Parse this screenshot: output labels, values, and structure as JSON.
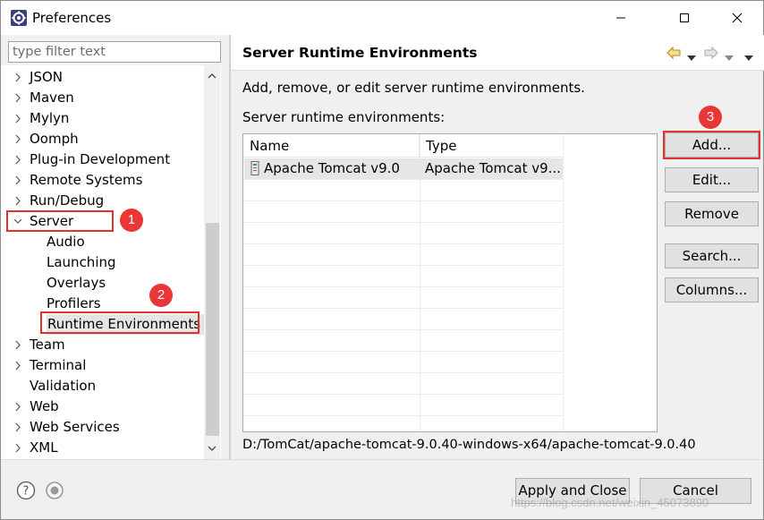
{
  "window": {
    "title": "Preferences",
    "icon": "eclipse-gear-icon"
  },
  "filter": {
    "placeholder": "type filter text"
  },
  "tree": {
    "items": [
      {
        "label": "JSON",
        "level": 0,
        "expandable": true
      },
      {
        "label": "Maven",
        "level": 0,
        "expandable": true
      },
      {
        "label": "Mylyn",
        "level": 0,
        "expandable": true
      },
      {
        "label": "Oomph",
        "level": 0,
        "expandable": true
      },
      {
        "label": "Plug-in Development",
        "level": 0,
        "expandable": true
      },
      {
        "label": "Remote Systems",
        "level": 0,
        "expandable": true
      },
      {
        "label": "Run/Debug",
        "level": 0,
        "expandable": true
      },
      {
        "label": "Server",
        "level": 0,
        "expandable": true,
        "expanded": true
      },
      {
        "label": "Audio",
        "level": 1,
        "expandable": false
      },
      {
        "label": "Launching",
        "level": 1,
        "expandable": false
      },
      {
        "label": "Overlays",
        "level": 1,
        "expandable": false
      },
      {
        "label": "Profilers",
        "level": 1,
        "expandable": false
      },
      {
        "label": "Runtime Environments",
        "level": 1,
        "expandable": false,
        "selected": true
      },
      {
        "label": "Team",
        "level": 0,
        "expandable": true
      },
      {
        "label": "Terminal",
        "level": 0,
        "expandable": true
      },
      {
        "label": "Validation",
        "level": 0,
        "expandable": false
      },
      {
        "label": "Web",
        "level": 0,
        "expandable": true
      },
      {
        "label": "Web Services",
        "level": 0,
        "expandable": true
      },
      {
        "label": "XML",
        "level": 0,
        "expandable": true
      }
    ]
  },
  "annotations": {
    "badge1": "1",
    "badge2": "2",
    "badge3": "3",
    "color": "#e93737"
  },
  "page": {
    "title": "Server Runtime Environments",
    "description": "Add, remove, or edit server runtime environments.",
    "list_label": "Server runtime environments:",
    "table": {
      "headers": [
        "Name",
        "Type"
      ],
      "rows": [
        {
          "name": "Apache Tomcat v9.0",
          "type": "Apache Tomcat v9..."
        }
      ]
    },
    "path": "D:/TomCat/apache-tomcat-9.0.40-windows-x64/apache-tomcat-9.0.40"
  },
  "buttons": {
    "add": "Add...",
    "edit": "Edit...",
    "remove": "Remove",
    "search": "Search...",
    "columns": "Columns..."
  },
  "footer": {
    "apply_close": "Apply and Close",
    "cancel": "Cancel",
    "watermark": "https://blog.csdn.net/weixin_45073890"
  }
}
